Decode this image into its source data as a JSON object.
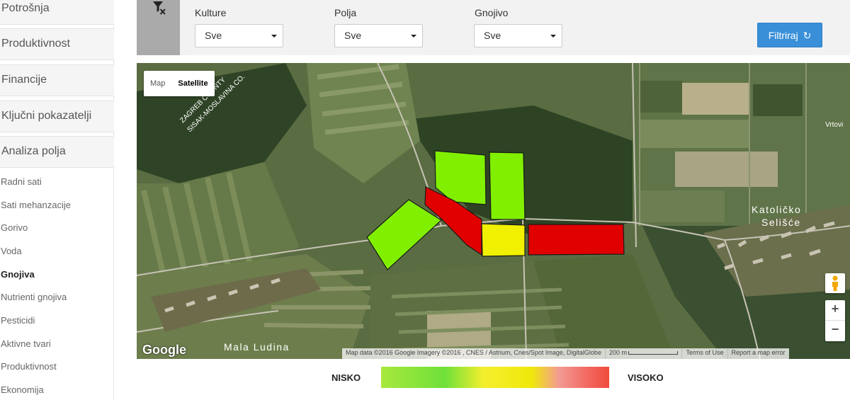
{
  "sidebar": {
    "sections": [
      {
        "label": "Potrošnja"
      },
      {
        "label": "Produktivnost"
      },
      {
        "label": "Financije"
      },
      {
        "label": "Ključni pokazatelji"
      },
      {
        "label": "Analiza polja"
      }
    ],
    "sub_items": [
      {
        "label": "Radni sati"
      },
      {
        "label": "Sati mehanzacije"
      },
      {
        "label": "Gorivo"
      },
      {
        "label": "Voda"
      },
      {
        "label": "Gnojiva",
        "active": true
      },
      {
        "label": "Nutrienti gnojiva"
      },
      {
        "label": "Pesticidi"
      },
      {
        "label": "Aktivne tvari"
      },
      {
        "label": "Produktivnost"
      },
      {
        "label": "Ekonomija"
      }
    ]
  },
  "filters": {
    "clear_icon": "filter-clear-icon",
    "kulture": {
      "label": "Kulture",
      "value": "Sve"
    },
    "polja": {
      "label": "Polja",
      "value": "Sve"
    },
    "gnojivo": {
      "label": "Gnojivo",
      "value": "Sve"
    },
    "apply_label": "Filtriraj",
    "apply_icon": "refresh-icon",
    "apply_color": "#3a8fd9"
  },
  "map": {
    "type_map_label": "Map",
    "type_satellite_label": "Satellite",
    "labels": {
      "county": "ZAGREB COUNTY",
      "county2": "SISAK-MOSLAVINA CO.",
      "town1_line1": "Katoličko",
      "town1_line2": "Selišće",
      "town2": "Mala Ludina",
      "edge": "Vrtovi"
    },
    "google_logo": "Google",
    "attribution": {
      "data": "Map data ©2016 Google Imagery ©2016 , CNES / Astrium, Cnes/Spot Image, DigitalGlobe",
      "scale": "200 m",
      "terms": "Terms of Use",
      "report": "Report a map error"
    },
    "zoom_in": "+",
    "zoom_out": "−",
    "field_colors": {
      "green": "#80f000",
      "red": "#e00000",
      "yellow": "#f0f000"
    }
  },
  "legend": {
    "low": "NISKO",
    "high": "VISOKO"
  }
}
